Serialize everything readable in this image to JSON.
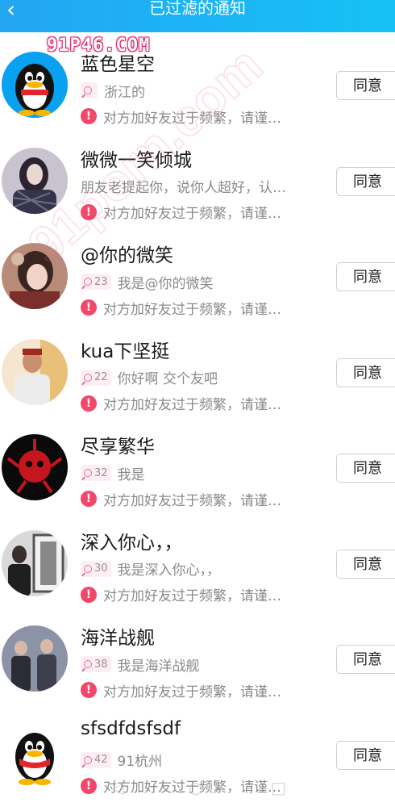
{
  "header": {
    "title": "已过滤的通知",
    "back_icon": "chevron-left-icon"
  },
  "watermark": {
    "text": "91P46.COM",
    "diagonal_text": "91porn.com"
  },
  "items": [
    {
      "name": "蓝色星空",
      "tag": "",
      "subtext": "浙江的",
      "warning": "对方加好友过于频繁，请谨…",
      "button": "同意",
      "avatar": "qq-penguin"
    },
    {
      "name": "微微一笑倾城",
      "tag": null,
      "subtext": "朋友老提起你，说你人超好，认…",
      "warning": "对方加好友过于频繁，请谨…",
      "button": "同意",
      "avatar": "photo"
    },
    {
      "name": "@你的微笑",
      "tag": "23",
      "subtext": "我是@你的微笑",
      "warning": "对方加好友过于频繁，请谨…",
      "button": "同意",
      "avatar": "photo"
    },
    {
      "name": "kua下坚挺",
      "tag": "22",
      "subtext": "你好啊 交个友吧",
      "warning": "对方加好友过于频繁，请谨…",
      "button": "同意",
      "avatar": "photo"
    },
    {
      "name": "尽享繁华",
      "tag": "32",
      "subtext": "我是",
      "warning": "对方加好友过于频繁，请谨…",
      "button": "同意",
      "avatar": "photo"
    },
    {
      "name": "深入你心，，",
      "tag": "30",
      "subtext": "我是深入你心，，",
      "warning": "对方加好友过于频繁，请谨…",
      "button": "同意",
      "avatar": "photo"
    },
    {
      "name": "海洋战舰",
      "tag": "38",
      "subtext": "我是海洋战舰",
      "warning": "对方加好友过于频繁，请谨…",
      "button": "同意",
      "avatar": "photo"
    },
    {
      "name": "sfsdfdsfsdf",
      "tag": "42",
      "subtext": "91杭州",
      "warning": "对方加好友过于频繁，请谨…",
      "button": "同意",
      "avatar": "qq-penguin"
    }
  ],
  "colors": {
    "header": "#1eb0f5",
    "warning": "#f2466a",
    "tag_bg": "#fdeef3"
  }
}
